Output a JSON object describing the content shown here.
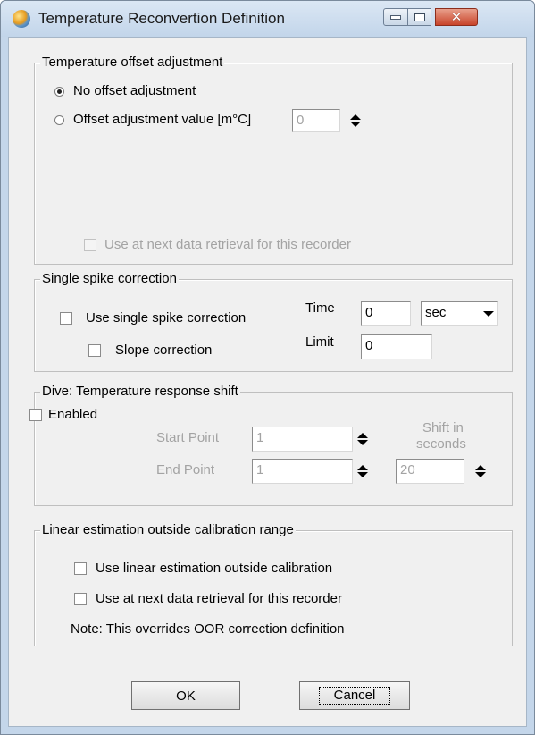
{
  "window": {
    "title": "Temperature Reconvertion Definition",
    "icons": {
      "app": "app-globe-icon",
      "minimize": "minimize-icon",
      "maximize": "maximize-icon",
      "close": "close-icon"
    }
  },
  "offset_group": {
    "title": "Temperature offset adjustment",
    "no_offset_label": "No offset adjustment",
    "no_offset_selected": true,
    "offset_value_label": "Offset adjustment value [m°C]",
    "offset_value": "0",
    "use_next_label": "Use at next data retrieval for this recorder",
    "use_next_checked": false
  },
  "spike_group": {
    "title": "Single spike correction",
    "use_label": "Use single spike correction",
    "use_checked": false,
    "slope_label": "Slope correction",
    "slope_checked": false,
    "time_label": "Time",
    "time_value": "0",
    "time_unit": "sec",
    "limit_label": "Limit",
    "limit_value": "0"
  },
  "dive_group": {
    "title": "Dive: Temperature response shift",
    "enabled_label": "Enabled",
    "enabled_checked": false,
    "start_label": "Start Point",
    "start_value": "1",
    "end_label": "End Point",
    "end_value": "1",
    "shift_label_line1": "Shift in",
    "shift_label_line2": "seconds",
    "shift_value": "20"
  },
  "linear_group": {
    "title": "Linear estimation outside calibration range",
    "use_label": "Use linear estimation outside calibration",
    "use_checked": false,
    "next_label": "Use at next data retrieval for this recorder",
    "next_checked": false,
    "note": "Note: This overrides OOR  correction definition"
  },
  "buttons": {
    "ok": "OK",
    "cancel": "Cancel"
  },
  "colors": {
    "title_bg": "#c4d6ea",
    "close_button": "#c8442a",
    "dialog_bg": "#f0f0f0",
    "disabled_text": "#a3a3a3"
  }
}
